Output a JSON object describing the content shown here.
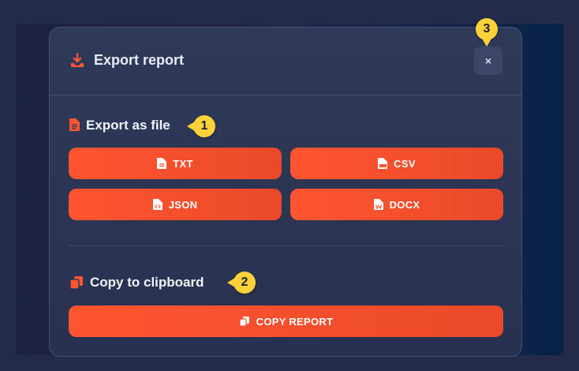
{
  "modal": {
    "title": "Export report",
    "close_label": "×"
  },
  "export_file": {
    "title": "Export as file",
    "buttons": [
      {
        "label": "TXT",
        "icon": "file-text-icon"
      },
      {
        "label": "CSV",
        "icon": "file-csv-icon"
      },
      {
        "label": "JSON",
        "icon": "file-code-icon"
      },
      {
        "label": "DOCX",
        "icon": "file-word-icon"
      }
    ]
  },
  "clipboard": {
    "title": "Copy to clipboard",
    "button_label": "COPY REPORT",
    "icon": "copy-icon"
  },
  "callouts": [
    "1",
    "2",
    "3"
  ],
  "colors": {
    "accent": "#ff5530",
    "callout": "#ffd23a",
    "modal_bg": "#2f3958"
  }
}
